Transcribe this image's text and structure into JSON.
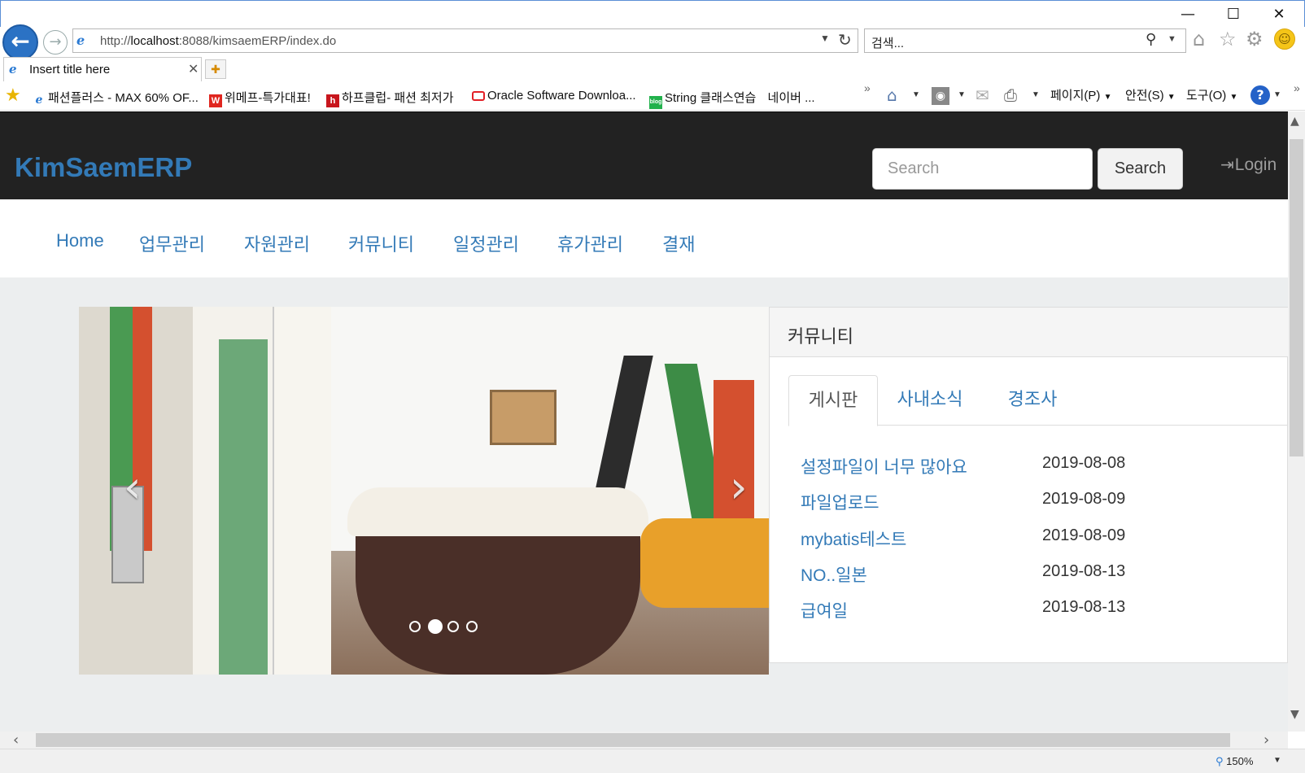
{
  "browser": {
    "window_controls": {
      "minimize": "—",
      "maximize": "☐",
      "close": "✕"
    },
    "address": {
      "url": "http://localhost:8088/kimsaemERP/index.do",
      "url_host": "localhost",
      "url_prefix": "http://",
      "url_rest": ":8088/kimsaemERP/index.do"
    },
    "search_placeholder": "검색...",
    "tab": {
      "title": "Insert title here"
    },
    "favorites": [
      {
        "label": "패션플러스 - MAX 60% OF...",
        "icon": "ie-page-icon"
      },
      {
        "label": "위메프-특가대표!",
        "icon": "wemakeprice-icon",
        "glyph": "W"
      },
      {
        "label": "하프클럽- 패션 최저가",
        "icon": "halfclub-icon",
        "glyph": "h"
      },
      {
        "label": "Oracle Software Downloa...",
        "icon": "oracle-icon",
        "glyph": ""
      },
      {
        "label": "String 클래스연습",
        "icon": "naver-blog-icon",
        "glyph": "blog"
      },
      {
        "label": "네이버 ..."
      }
    ],
    "commands": {
      "page": "페이지(P)",
      "safety": "안전(S)",
      "tools": "도구(O)",
      "help": "?"
    },
    "zoom": "150%"
  },
  "site": {
    "brand": "KimSaemERP",
    "search_placeholder": "Search",
    "search_button": "Search",
    "login": "Login",
    "menu": [
      "Home",
      "업무관리",
      "자원관리",
      "커뮤니티",
      "일정관리",
      "휴가관리",
      "결재"
    ],
    "carousel": {
      "slide_count": 4,
      "active_index": 1
    },
    "community": {
      "title": "커뮤니티",
      "tabs": [
        "게시판",
        "사내소식",
        "경조사"
      ],
      "active_tab": 0,
      "posts": [
        {
          "title": "설정파일이 너무 많아요",
          "date": "2019-08-08"
        },
        {
          "title": "파일업로드",
          "date": "2019-08-09"
        },
        {
          "title": "mybatis테스트",
          "date": "2019-08-09"
        },
        {
          "title": "NO..일본",
          "date": "2019-08-13"
        },
        {
          "title": "급여일",
          "date": "2019-08-13"
        }
      ]
    }
  },
  "colors": {
    "link": "#337ab7",
    "navbar": "#222222",
    "body_bg": "#eceeef"
  }
}
